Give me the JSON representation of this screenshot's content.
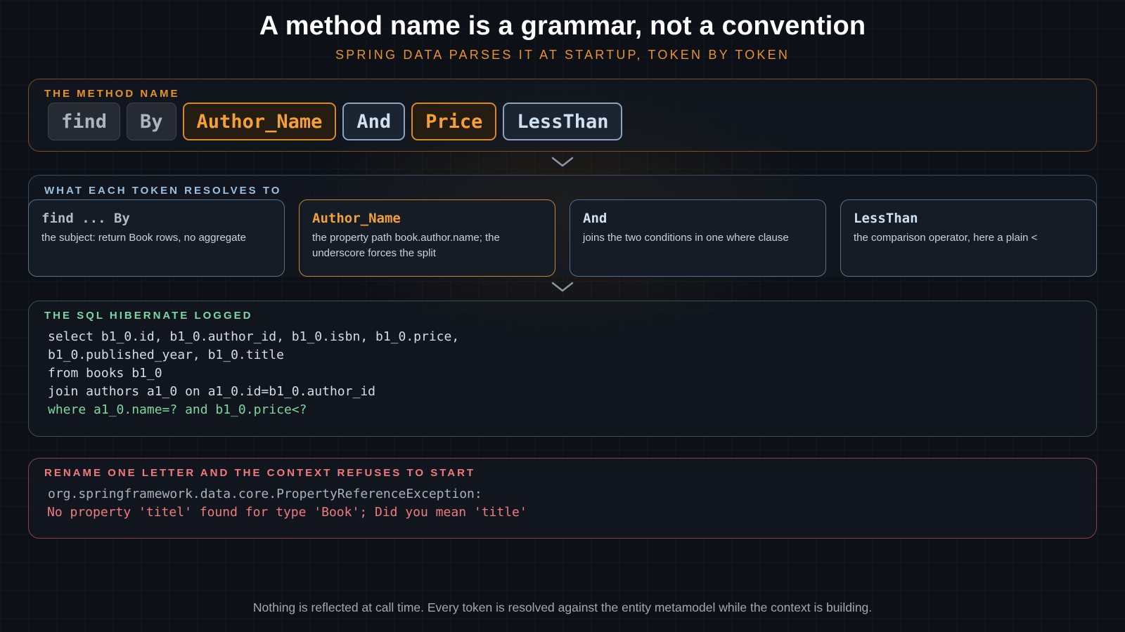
{
  "title": "A method name is a grammar, not a convention",
  "subtitle": "SPRING DATA PARSES IT AT STARTUP, TOKEN BY TOKEN",
  "method_panel": {
    "label": "THE METHOD NAME",
    "tokens": [
      "find",
      "By",
      "Author_Name",
      "And",
      "Price",
      "LessThan"
    ]
  },
  "resolve_panel": {
    "label": "WHAT EACH TOKEN RESOLVES TO",
    "cards": [
      {
        "title": "find ... By",
        "desc": "the subject: return Book rows, no aggregate"
      },
      {
        "title": "Author_Name",
        "desc": "the property path book.author.name; the underscore forces the split"
      },
      {
        "title": "And",
        "desc": "joins the two conditions in one where clause"
      },
      {
        "title": "LessThan",
        "desc": "the comparison operator, here a plain <"
      }
    ]
  },
  "sql_panel": {
    "label": "THE SQL HIBERNATE LOGGED",
    "lines": [
      "select b1_0.id, b1_0.author_id, b1_0.isbn, b1_0.price,",
      "b1_0.published_year, b1_0.title",
      "from books b1_0",
      "join authors a1_0 on a1_0.id=b1_0.author_id",
      "where a1_0.name=? and b1_0.price<?"
    ]
  },
  "error_panel": {
    "label": "RENAME ONE LETTER AND THE CONTEXT REFUSES TO START",
    "line1": "org.springframework.data.core.PropertyReferenceException:",
    "line2": "No property 'titel' found for type 'Book'; Did you mean 'title'"
  },
  "footer": "Nothing is reflected at call time. Every token is resolved against the entity metamodel while the context is building.",
  "colors": {
    "accent_orange": "#e8922c",
    "accent_blue": "#9cc0e0",
    "accent_green": "#7ed6a0",
    "accent_red": "#f07a7e"
  },
  "icons": [
    "chevron-down-icon",
    "chevron-down-icon"
  ]
}
